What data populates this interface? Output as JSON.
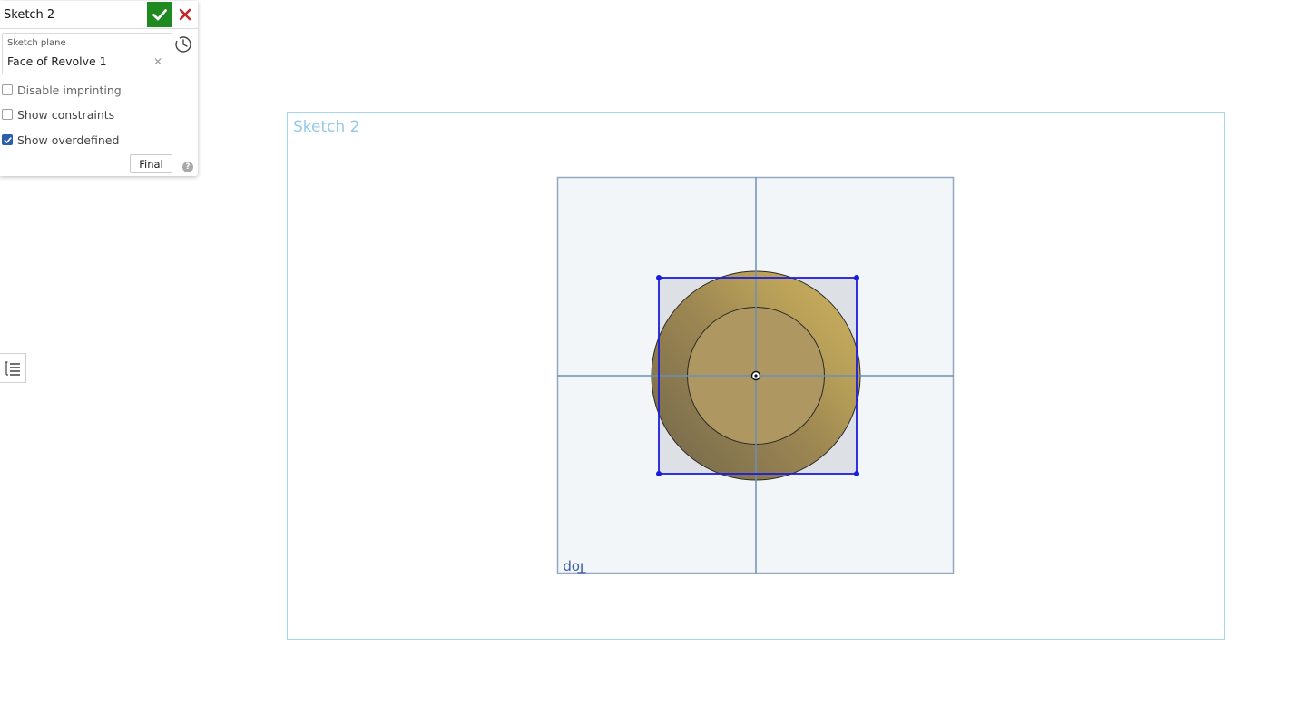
{
  "dialog": {
    "title": "Sketch 2",
    "accept_icon": "checkmark-icon",
    "cancel_icon": "close-icon",
    "sketch_plane": {
      "label": "Sketch plane",
      "value": "Face of Revolve 1",
      "clear_icon": "clear-x-icon"
    },
    "history_icon": "clock-history-icon",
    "options": [
      {
        "label": "Disable imprinting",
        "checked": false
      },
      {
        "label": "Show constraints",
        "checked": false
      },
      {
        "label": "Show overdefined",
        "checked": true
      }
    ],
    "final_button": "Final",
    "help_icon": "help-icon"
  },
  "side_toggle": {
    "icon": "feature-list-icon"
  },
  "viewport": {
    "sketch_label": "Sketch 2",
    "plane_label": "Top",
    "colors": {
      "frame": "#a8d5ee",
      "plane_fill": "#f3f6f9",
      "plane_edge": "#93a8c2",
      "axis": "#6b8fb5",
      "rectangle": "#1c1cdd",
      "face": "#b59d5a"
    }
  }
}
